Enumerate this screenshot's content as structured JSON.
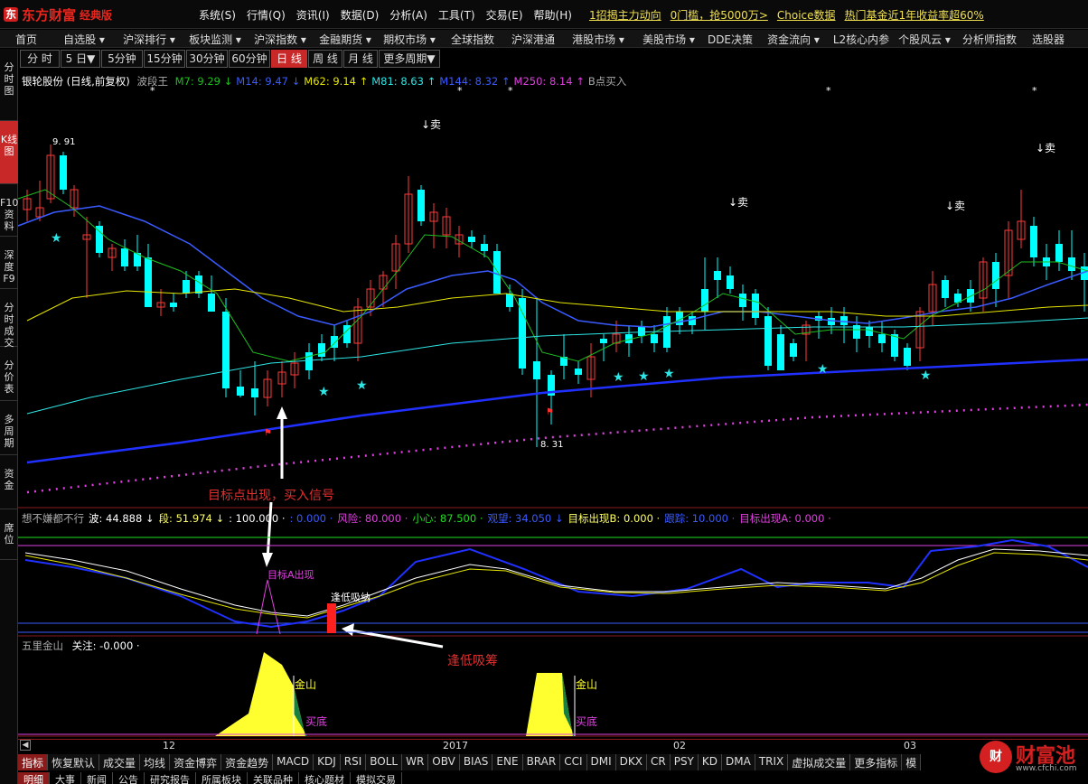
{
  "app": {
    "logo_mark": "东",
    "name": "东方财富",
    "edition": "经典版"
  },
  "menu": [
    "系统(S)",
    "行情(Q)",
    "资讯(I)",
    "数据(D)",
    "分析(A)",
    "工具(T)",
    "交易(E)",
    "帮助(H)"
  ],
  "promos": [
    "1招揭主力动向",
    "0门槛，抢5000万>",
    "Choice数据",
    "热门基金近1年收益率超60%"
  ],
  "nav": [
    "首页",
    "自选股 ▾",
    "沪深排行 ▾",
    "板块监测 ▾",
    "沪深指数 ▾",
    "金融期货 ▾",
    "期权市场 ▾",
    "全球指数",
    "沪深港通",
    "港股市场 ▾",
    "美股市场 ▾",
    "DDE决策",
    "资金流向 ▾",
    "L2核心内参",
    "个股风云 ▾",
    "分析师指数",
    "选股器"
  ],
  "sidebar": [
    "分时图",
    "K线图",
    "F10资料",
    "深度F9",
    "分时成交",
    "分价表",
    "多周期",
    "资金",
    "席位"
  ],
  "periods": [
    "分 时",
    "5 日▼",
    "5分钟",
    "15分钟",
    "30分钟",
    "60分钟",
    "日 线",
    "周 线",
    "月 线",
    "更多周期▼"
  ],
  "stock": {
    "title": "银轮股份 (日线,前复权)",
    "indicator": "波段王"
  },
  "ma_legend": [
    {
      "text": "M7: 9.29 ↓",
      "color": "#1fbf1f"
    },
    {
      "text": "M14: 9.47 ↓",
      "color": "#3a5bff"
    },
    {
      "text": "M62: 9.14 ↑",
      "color": "#e6e600"
    },
    {
      "text": "M81: 8.63 ↑",
      "color": "#2ee6e6"
    },
    {
      "text": "M144: 8.32 ↑",
      "color": "#3a5bff"
    },
    {
      "text": "M250: 8.14 ↑",
      "color": "#e040e0"
    },
    {
      "text": "B点买入",
      "color": "#aaaaaa"
    }
  ],
  "price_labels": {
    "high": "9. 91",
    "low": "8. 31"
  },
  "sell_label": "↓卖",
  "annotations": {
    "buy_signal": "目标点出现，买入信号",
    "low_accumulate": "逢低吸筹"
  },
  "indicator_legend": [
    {
      "text": "想不嫌都不行",
      "color": "#aaaaaa"
    },
    {
      "text": "波: 44.888 ↓",
      "color": "#ffffff"
    },
    {
      "text": "段: 51.974 ↓",
      "color": "#ffff66"
    },
    {
      "text": ": 100.000 ·",
      "color": "#ffffff"
    },
    {
      "text": ": 0.000 ·",
      "color": "#3a5bff"
    },
    {
      "text": "风险: 80.000 ·",
      "color": "#e040e0"
    },
    {
      "text": "小心: 87.500 ·",
      "color": "#1fdf1f"
    },
    {
      "text": "观望: 34.050 ↓",
      "color": "#3a5bff"
    },
    {
      "text": "目标出现B: 0.000 ·",
      "color": "#ffff66"
    },
    {
      "text": "跟踪: 10.000 ·",
      "color": "#3a5bff"
    },
    {
      "text": "目标出现A: 0.000 ·",
      "color": "#e040e0"
    }
  ],
  "indicator_labels": {
    "target_a": "目标A出现",
    "low_buy": "逢低吸纳"
  },
  "wl_legend": {
    "name": "五里金山",
    "focus": "关注: -0.000 ·"
  },
  "wl_labels": {
    "jinshan": "金山",
    "maidi": "买底"
  },
  "xaxis": [
    "12",
    "2017",
    "02",
    "03"
  ],
  "bottom_tabs": [
    "指标",
    "恢复默认",
    "成交量",
    "均线",
    "资金博弈",
    "资金趋势",
    "MACD",
    "KDJ",
    "RSI",
    "BOLL",
    "WR",
    "OBV",
    "BIAS",
    "ENE",
    "BRAR",
    "CCI",
    "DMI",
    "DKX",
    "CR",
    "PSY",
    "KD",
    "DMA",
    "TRIX",
    "虚拟成交量",
    "更多指标",
    "模"
  ],
  "bottom_tabs2": [
    "明细",
    "大事",
    "新闻",
    "公告",
    "研究报告",
    "所属板块",
    "关联品种",
    "核心题材",
    "模拟交易"
  ],
  "watermark": {
    "logo": "财",
    "text": "财富池",
    "url": "www.cfchi.com"
  },
  "colors": {
    "up": "#ff3b3b",
    "down": "#00ffff",
    "accent": "#c82828"
  }
}
